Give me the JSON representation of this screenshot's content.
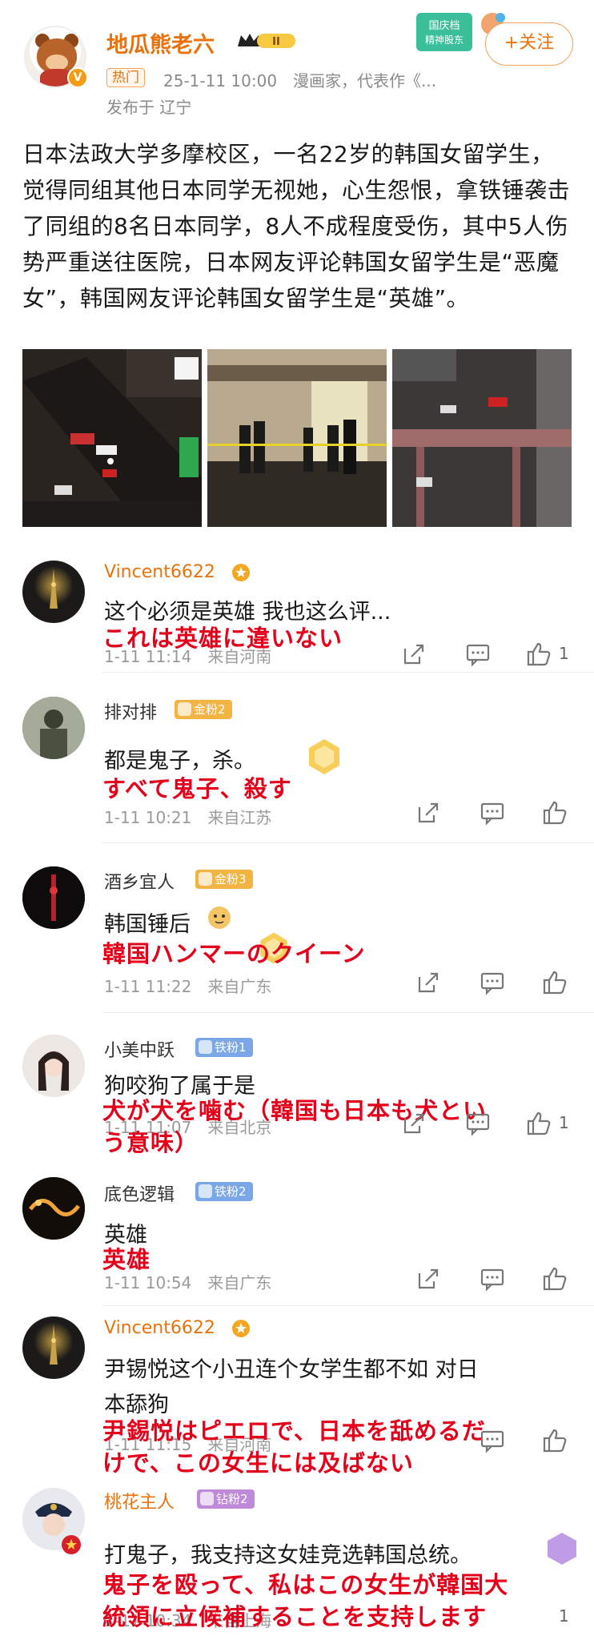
{
  "post": {
    "username": "地瓜熊老六",
    "level_badge": "II",
    "hot_tag": "热门",
    "meta": "25-1-11 10:00　漫画家，代表作《...",
    "location": "发布于 辽宁",
    "follow_label": "+关注",
    "promo_text_1": "国庆档",
    "promo_text_2": "精神股东",
    "text": "日本法政大学多摩校区，一名22岁的韩国女留学生，觉得同组其他日本同学无视她，心生怨恨，拿铁锤袭击了同组的8名日本同学，8人不成程度受伤，其中5人伤势严重送往医院，日本网友评论韩国女留学生是“恶魔女”，韩国网友评论韩国女留学生是“英雄”。"
  },
  "comments": [
    {
      "name": "Vincent6622",
      "text": "这个必须是英雄 我也这么评...",
      "jp": "これは英雄に違いない",
      "meta": "1-11 11:14　来自河南",
      "likes": "1"
    },
    {
      "name": "排对排",
      "badge": "金粉2",
      "text": "都是鬼子，杀。",
      "jp": "すべて鬼子、殺す",
      "meta": "1-11 10:21　来自江苏",
      "likes": ""
    },
    {
      "name": "酒乡宜人",
      "badge": "金粉3",
      "text": "韩国锤后",
      "jp": "韓国ハンマーのクイーン",
      "meta": "1-11 11:22　来自广东",
      "likes": ""
    },
    {
      "name": "小美中跃",
      "badge": "铁粉1",
      "text": "狗咬狗了属于是",
      "jp_line1": "犬が犬を噛む（韓国も日本も犬とい",
      "jp_line2": "う意味）",
      "meta": "1-11 11:07　来自北京",
      "likes": "1"
    },
    {
      "name": "底色逻辑",
      "badge": "铁粉2",
      "text": "英雄",
      "jp": "英雄",
      "meta": "1-11 10:54　来自广东",
      "likes": ""
    },
    {
      "name": "Vincent6622",
      "text_line1": "尹锡悦这个小丑连个女学生都不如 对日",
      "text_line2": "本舔狗",
      "jp_line1": "尹錫悦はピエロで、日本を舐めるだ",
      "jp_line2": "けで、この女生には及ばない",
      "meta": "1-11 11:15　来自河南",
      "likes": ""
    },
    {
      "name": "桃花主人",
      "badge": "钻粉2",
      "text": "打鬼子，我支持这女娃竞选韩国总统。",
      "jp_line1": "鬼子を殴って、私はこの女生が韓国大",
      "jp_line2": "統領に立候補することを支持します",
      "meta": "1-11 10:34　来自上海",
      "likes": "1"
    }
  ],
  "colors": {
    "accent": "#e8720c",
    "jp_overlay": "#e3001b",
    "meta": "#9a9a9a"
  }
}
